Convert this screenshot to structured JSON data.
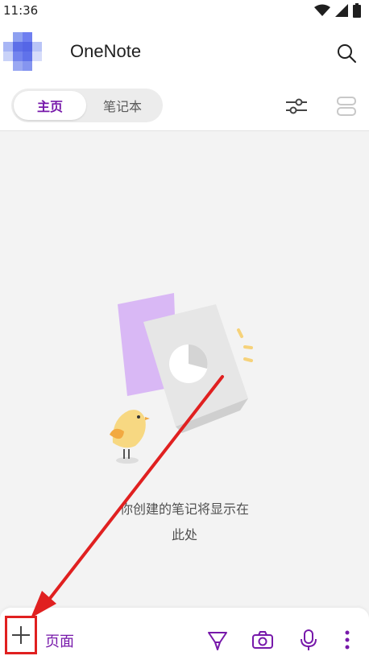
{
  "status_bar": {
    "time": "11:36",
    "icons": [
      "wifi-icon",
      "signal-icon",
      "battery-icon"
    ]
  },
  "header": {
    "avatar_icon": "pixelated-avatar",
    "app_title": "OneNote",
    "search_icon": "search-icon"
  },
  "tabs": [
    {
      "label": "主页",
      "active": true
    },
    {
      "label": "笔记本",
      "active": false
    }
  ],
  "toolbar_icons": {
    "filter": "sliders-icon",
    "view": "view-toggle-icon"
  },
  "empty_state": {
    "line1": "你创建的笔记将显示在",
    "line2": "此处"
  },
  "bottom_bar": {
    "add_icon": "plus-icon",
    "add_label": "页面",
    "tools": [
      "pen-icon",
      "camera-icon",
      "microphone-icon",
      "more-vertical-icon"
    ]
  },
  "colors": {
    "accent": "#7719aa",
    "annotation": "#e02020",
    "background": "#f3f3f3"
  }
}
